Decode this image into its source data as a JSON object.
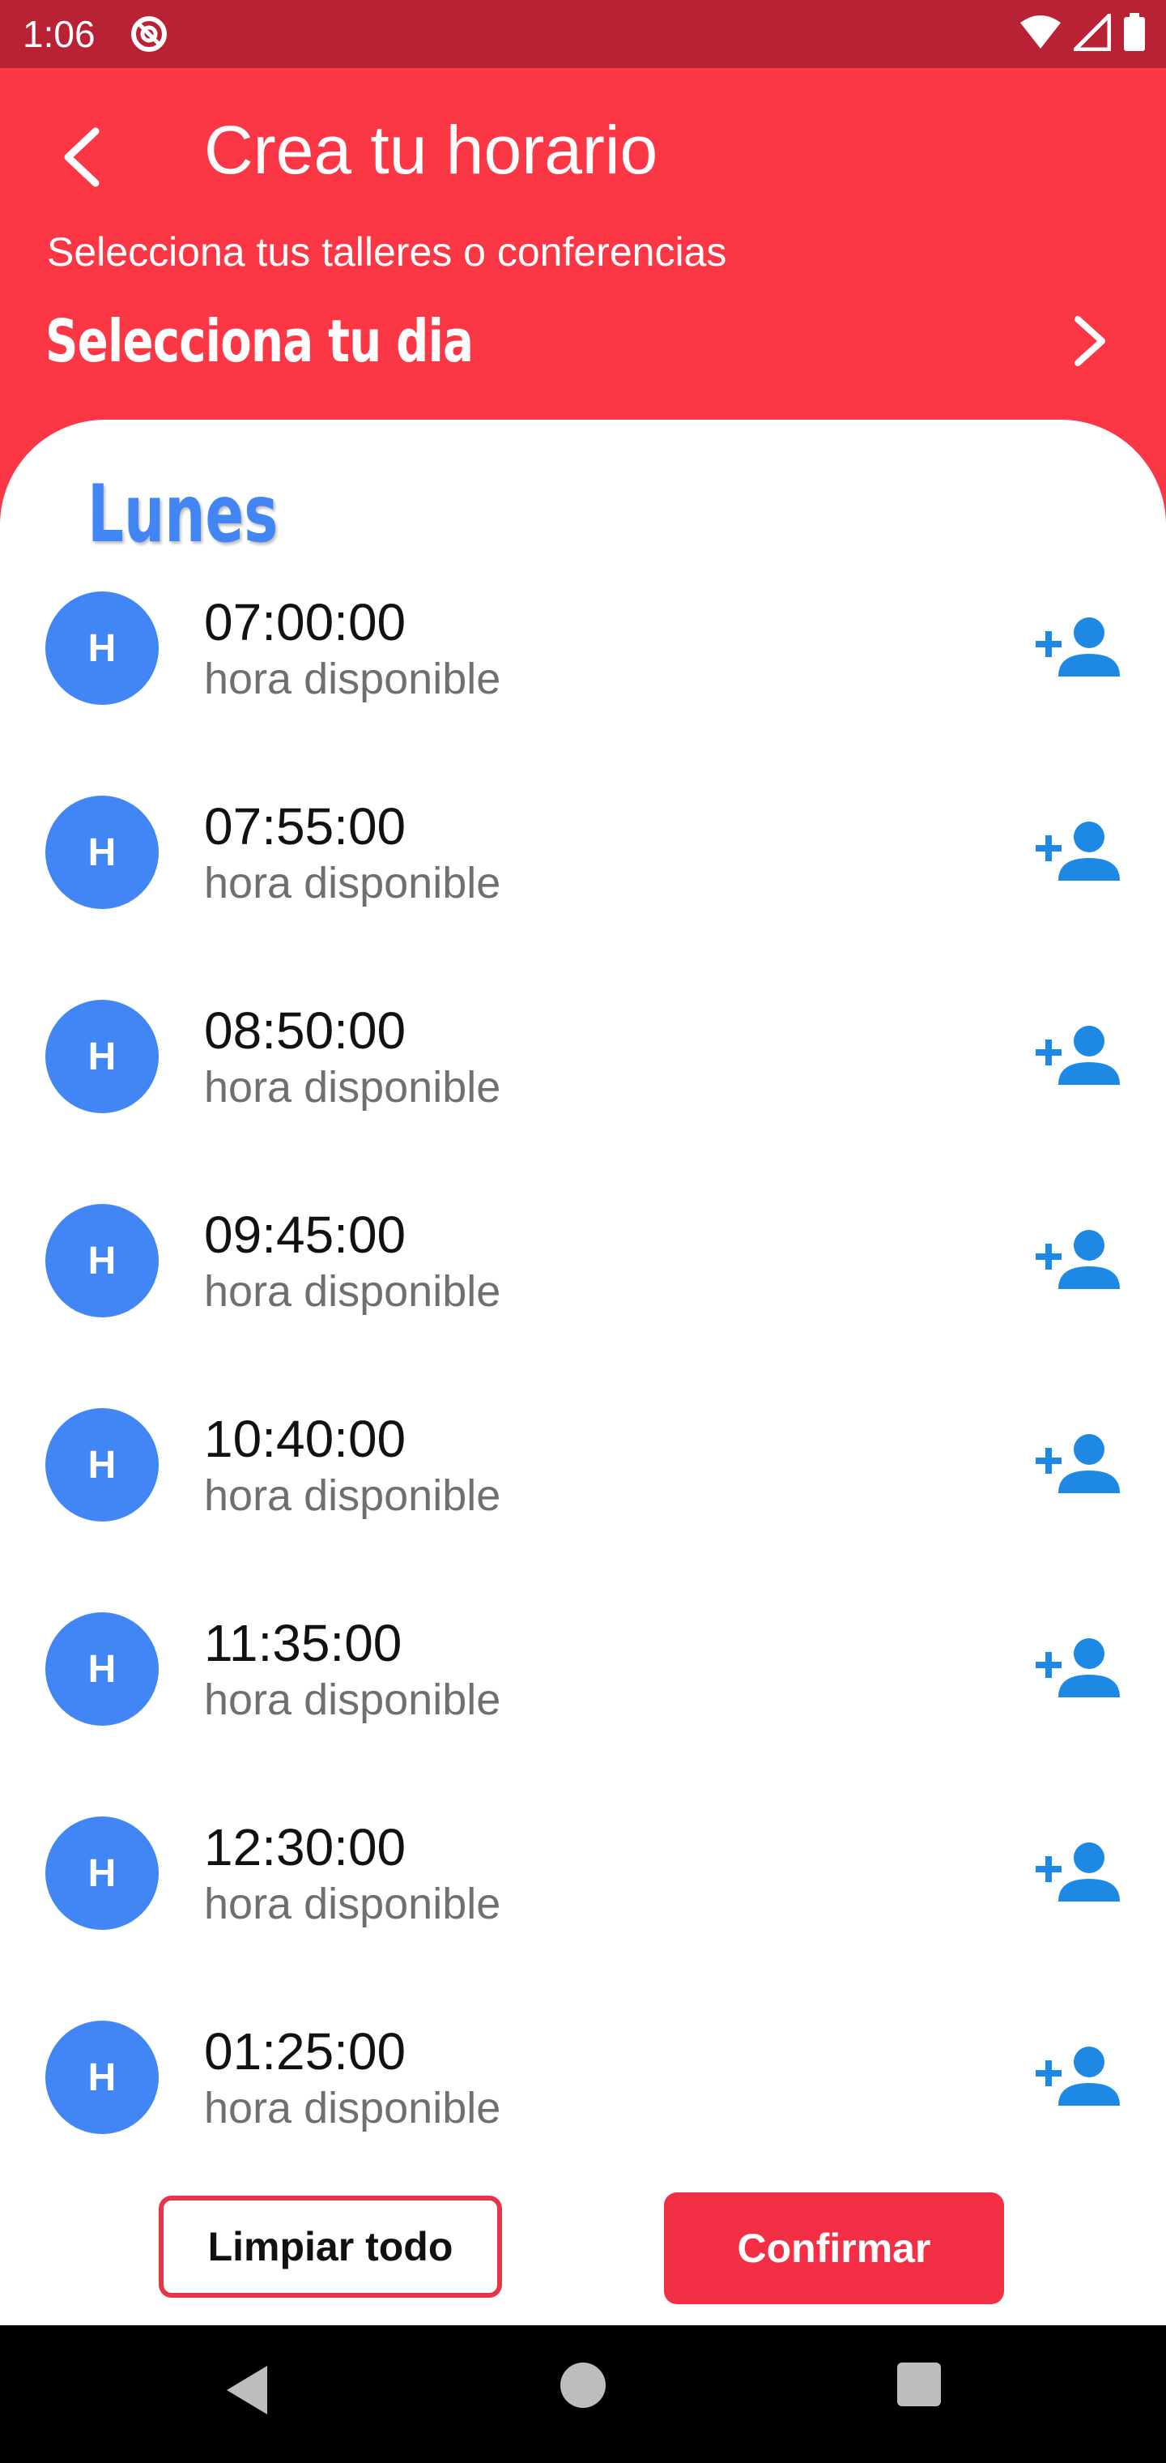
{
  "status_bar": {
    "time": "1:06",
    "icons": [
      "do-not-disturb-icon",
      "wifi-icon",
      "cell-signal-icon",
      "battery-icon"
    ]
  },
  "header": {
    "title": "Crea tu horario",
    "subtitle": "Selecciona tus talleres o conferencias",
    "day_selector_label": "Selecciona tu dia",
    "background_color": "#fb3746"
  },
  "schedule": {
    "day": "Lunes",
    "slots": [
      {
        "avatar": "H",
        "time": "07:00:00",
        "status": "hora disponible"
      },
      {
        "avatar": "H",
        "time": "07:55:00",
        "status": "hora disponible"
      },
      {
        "avatar": "H",
        "time": "08:50:00",
        "status": "hora disponible"
      },
      {
        "avatar": "H",
        "time": "09:45:00",
        "status": "hora disponible"
      },
      {
        "avatar": "H",
        "time": "10:40:00",
        "status": "hora disponible"
      },
      {
        "avatar": "H",
        "time": "11:35:00",
        "status": "hora disponible"
      },
      {
        "avatar": "H",
        "time": "12:30:00",
        "status": "hora disponible"
      },
      {
        "avatar": "H",
        "time": "01:25:00",
        "status": "hora disponible"
      }
    ]
  },
  "actions": {
    "clear_label": "Limpiar todo",
    "confirm_label": "Confirmar",
    "accent_color": "#f22f44"
  },
  "colors": {
    "avatar": "#4285f4",
    "add_icon": "#1e88e5",
    "status_bar": "#b82234"
  }
}
